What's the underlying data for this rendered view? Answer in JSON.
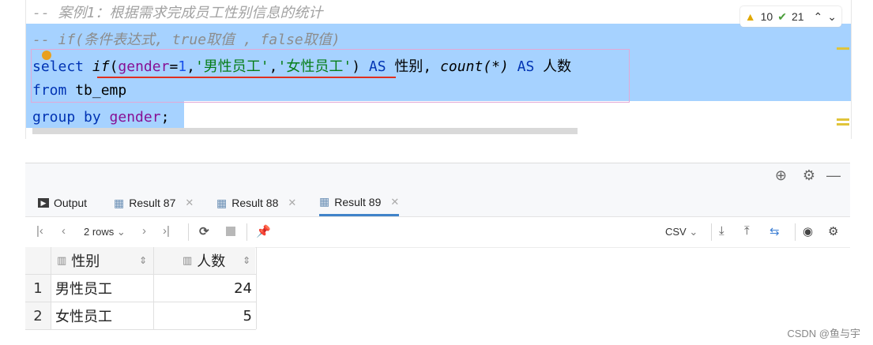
{
  "editor": {
    "line1": "-- 案例1：根据需求完成员工性别信息的统计",
    "line2": "-- if(条件表达式, true取值 , false取值)",
    "line3": {
      "select": "select",
      "if": "if",
      "paren_open": "(",
      "gender": "gender",
      "eq": "=",
      "one": "1",
      "comma1": ",",
      "str1": "'男性员工'",
      "comma2": ",",
      "str2": "'女性员工'",
      "paren_close": ")",
      "as1": "AS",
      "alias1": "性别,",
      "count": "count",
      "count_args": "(*)",
      "as2": "AS",
      "alias2": "人数"
    },
    "line4": {
      "from": "from",
      "table": "tb_emp"
    },
    "line5": {
      "group_by": "group by",
      "gender": "gender",
      "semi": ";"
    },
    "warnings": "10",
    "checks": "21"
  },
  "tabs": [
    {
      "label": "Output",
      "icon": "console-icon"
    },
    {
      "label": "Result 87",
      "icon": "table-icon"
    },
    {
      "label": "Result 88",
      "icon": "table-icon"
    },
    {
      "label": "Result 89",
      "icon": "table-icon"
    }
  ],
  "toolbar": {
    "rows": "2 rows",
    "export_format": "CSV"
  },
  "table": {
    "columns": [
      "性别",
      "人数"
    ],
    "rows": [
      {
        "num": "1",
        "gender": "男性员工",
        "count": "24"
      },
      {
        "num": "2",
        "gender": "女性员工",
        "count": "5"
      }
    ]
  },
  "watermark": "CSDN @鱼与宇",
  "colors": {
    "selection": "#a6d2ff",
    "keyword": "#0033b3",
    "string": "#067d17",
    "column": "#871094",
    "tab_underline": "#4083c9"
  }
}
